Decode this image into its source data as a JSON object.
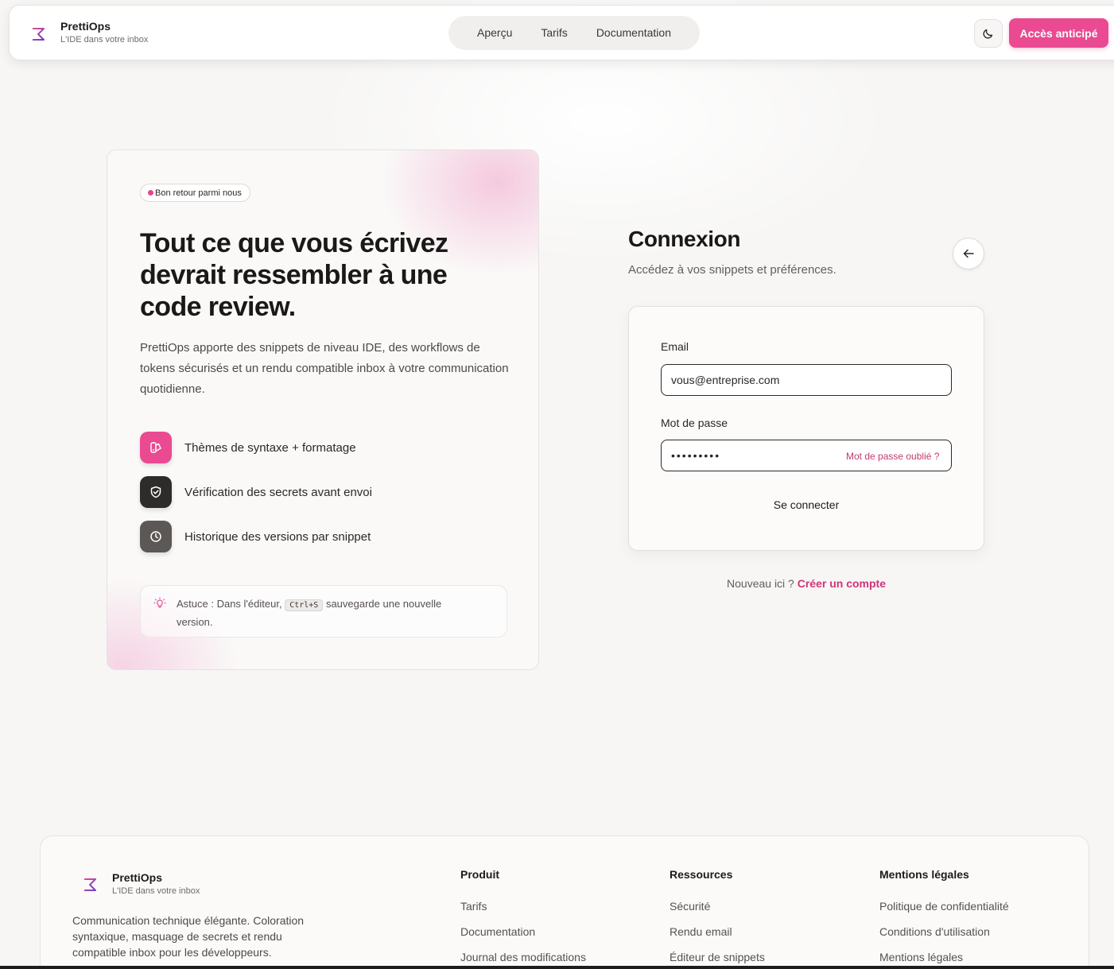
{
  "brand": {
    "name": "PrettiOps",
    "tagline": "L'IDE dans votre inbox"
  },
  "nav": {
    "items": [
      "Aperçu",
      "Tarifs",
      "Documentation"
    ]
  },
  "header": {
    "cta_label": "Accès anticipé"
  },
  "hero": {
    "badge": "Bon retour parmi nous",
    "title": "Tout ce que vous écrivez devrait ressembler à une code review.",
    "description": "PrettiOps apporte des snippets de niveau IDE, des workflows de tokens sécurisés et un rendu compatible inbox à votre communication quotidienne.",
    "features": [
      {
        "label": "Thèmes de syntaxe + formatage",
        "icon": "palette-icon"
      },
      {
        "label": "Vérification des secrets avant envoi",
        "icon": "shield-check-icon"
      },
      {
        "label": "Historique des versions par snippet",
        "icon": "clock-icon"
      }
    ],
    "tip": {
      "prefix": "Astuce : Dans l'éditeur,",
      "kbd": "Ctrl+S",
      "suffix": "sauvegarde une nouvelle version."
    }
  },
  "login": {
    "title": "Connexion",
    "subtitle": "Accédez à vos snippets et préférences.",
    "email_label": "Email",
    "email_value": "vous@entreprise.com",
    "password_label": "Mot de passe",
    "password_value": "•••••••••",
    "forgot_label": "Mot de passe oublié ?",
    "submit_label": "Se connecter",
    "signup_prompt": "Nouveau ici ?",
    "signup_link": "Créer un compte"
  },
  "footer": {
    "description": "Communication technique élégante. Coloration syntaxique, masquage de secrets et rendu compatible inbox pour les développeurs.",
    "columns": [
      {
        "title": "Produit",
        "links": [
          "Tarifs",
          "Documentation",
          "Journal des modifications"
        ]
      },
      {
        "title": "Ressources",
        "links": [
          "Sécurité",
          "Rendu email",
          "Éditeur de snippets"
        ]
      },
      {
        "title": "Mentions légales",
        "links": [
          "Politique de confidentialité",
          "Conditions d'utilisation",
          "Mentions légales"
        ]
      }
    ]
  },
  "colors": {
    "accent": "#ea4a91",
    "dark_icon": "#2e2c2b",
    "muted_icon": "#5c5856"
  }
}
